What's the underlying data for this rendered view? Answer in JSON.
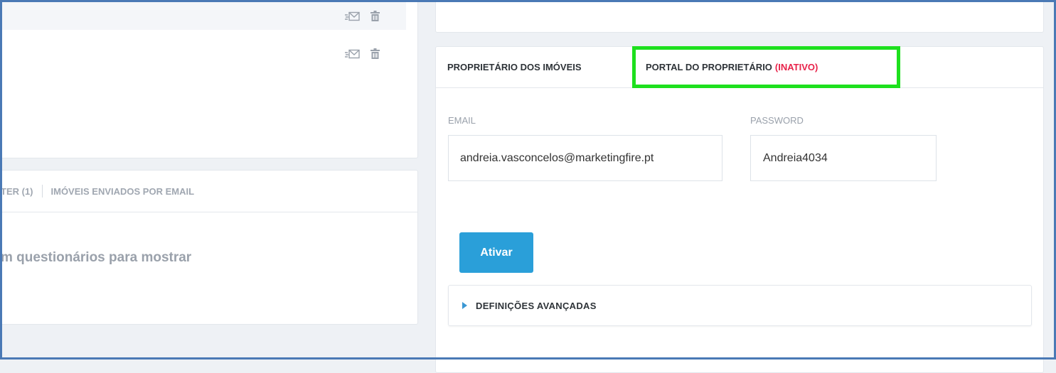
{
  "left_list": {
    "rows": [
      {
        "actions": [
          "send-email-icon",
          "trash-icon"
        ]
      },
      {
        "actions": [
          "send-email-icon",
          "trash-icon"
        ]
      }
    ]
  },
  "left_tabs": {
    "tab_partial": "TER (1)",
    "tab_emails": "IMÓVEIS ENVIADOS POR EMAIL"
  },
  "left_empty_message": "m questionários para mostrar",
  "owner_panel": {
    "tabs": [
      {
        "label": "PROPRIETÁRIO DOS IMÓVEIS"
      },
      {
        "label": "PORTAL DO PROPRIETÁRIO",
        "status": "(INATIVO)"
      }
    ],
    "email": {
      "label": "EMAIL",
      "value": "andreia.vasconcelos@marketingfire.pt"
    },
    "password": {
      "label": "PASSWORD",
      "value": "Andreia4034"
    },
    "activate_button": "Ativar",
    "advanced_settings": "DEFINIÇÕES AVANÇADAS"
  },
  "colors": {
    "accent": "#2a9fd9",
    "highlight": "#1ee01e",
    "inactive": "#e8234a",
    "frame": "#4a79b5"
  }
}
